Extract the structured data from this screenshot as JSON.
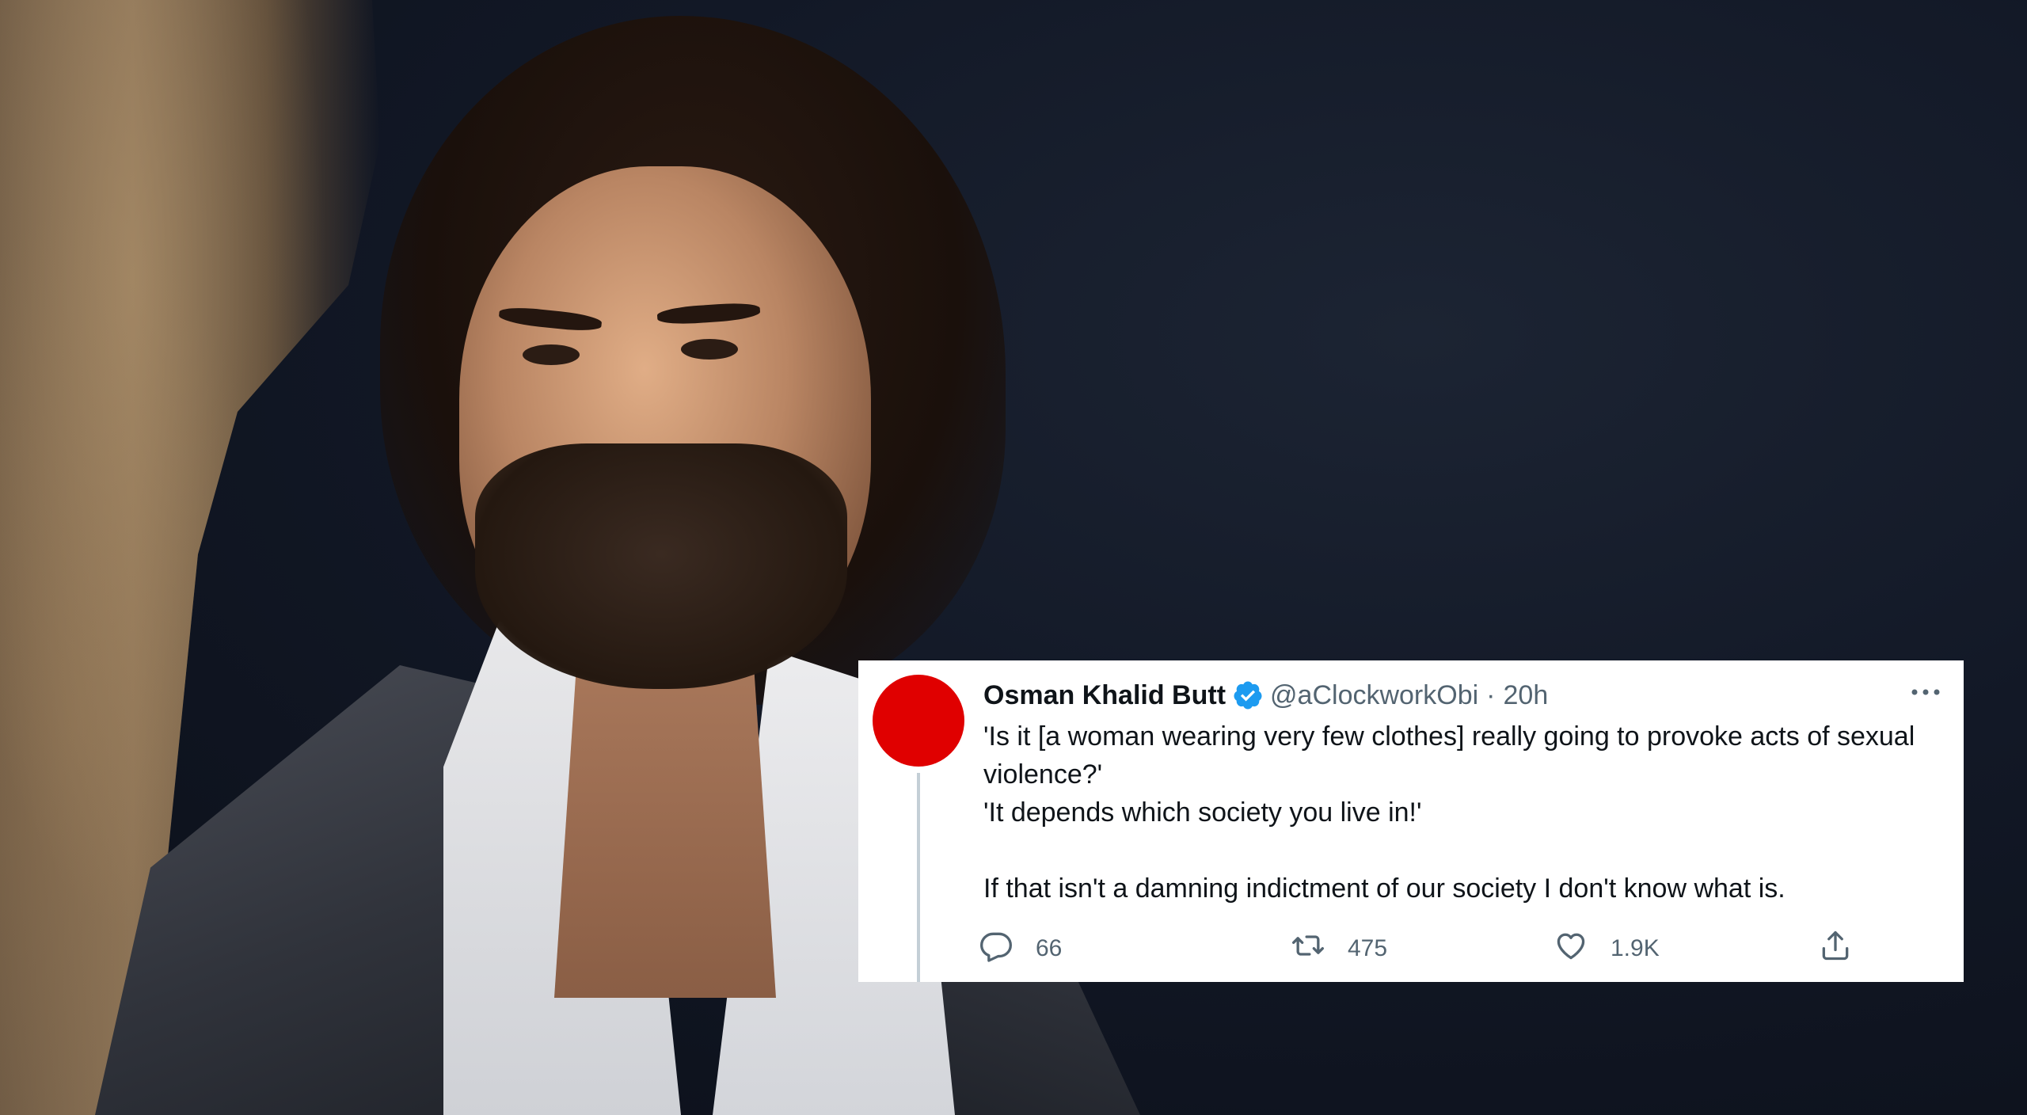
{
  "tweet": {
    "display_name": "Osman Khalid Butt",
    "handle": "@aClockworkObi",
    "separator": "·",
    "time": "20h",
    "lines": [
      "'Is it [a woman wearing very few clothes] really going to provoke acts of sexual violence?'",
      "'It depends which society you live in!'",
      "If that isn't a damning indictment of our society I don't know what is."
    ],
    "replies": "66",
    "retweets": "475",
    "likes": "1.9K",
    "verified": true,
    "icons": {
      "reply": "reply-icon",
      "retweet": "retweet-icon",
      "like": "heart-icon",
      "share": "share-icon",
      "more": "more-icon",
      "verified": "verified-badge-icon"
    }
  },
  "colors": {
    "avatar": "#e00000",
    "verified": "#1d9bf0",
    "secondary_text": "#536471",
    "primary_text": "#0f1419",
    "card_background": "#ffffff",
    "photo_background": "#121826"
  }
}
